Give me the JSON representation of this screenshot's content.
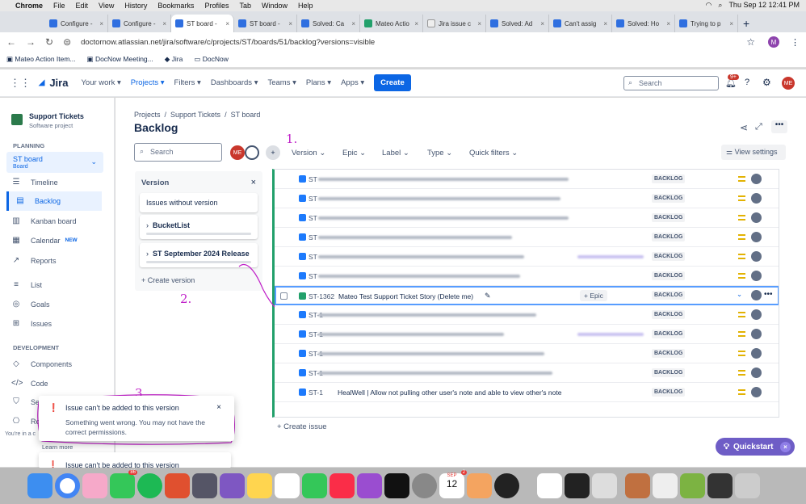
{
  "mac_menu": {
    "apple": "",
    "app": "Chrome",
    "items": [
      "File",
      "Edit",
      "View",
      "History",
      "Bookmarks",
      "Profiles",
      "Tab",
      "Window",
      "Help"
    ],
    "clock": "Thu Sep 12  12:41 PM"
  },
  "tabs": [
    "Configure -",
    "Configure -",
    "ST board -",
    "ST board -",
    "Solved: Ca",
    "Mateo Actio",
    "Jira issue c",
    "Solved: Ad",
    "Can't assig",
    "Solved: Ho",
    "Trying to p"
  ],
  "address": {
    "url": "doctornow.atlassian.net/jira/software/c/projects/ST/boards/51/backlog?versions=visible",
    "profile": "M"
  },
  "bookmarks": [
    "Mateo Action Item...",
    "DocNow Meeting...",
    "Jira",
    "DocNow"
  ],
  "jira_header": {
    "logo": "Jira",
    "nav": [
      "Your work",
      "Projects",
      "Filters",
      "Dashboards",
      "Teams",
      "Plans",
      "Apps"
    ],
    "create": "Create",
    "search": "Search",
    "notif": "9+",
    "avatar": "ME"
  },
  "sidebar": {
    "project": "Support Tickets",
    "project_type": "Software project",
    "planning": "PLANNING",
    "board": "ST board",
    "board_sub": "Board",
    "items": [
      "Timeline",
      "Backlog",
      "Kanban board",
      "Calendar",
      "Reports",
      "List",
      "Goals",
      "Issues"
    ],
    "new_badge": "NEW",
    "development": "DEVELOPMENT",
    "dev_items": [
      "Components",
      "Code",
      "Se",
      "Re"
    ],
    "footer": "You're in a c"
  },
  "main": {
    "breadcrumb": [
      "Projects",
      "Support Tickets",
      "ST board"
    ],
    "title": "Backlog",
    "search": "Search",
    "filters": [
      "Version",
      "Epic",
      "Label",
      "Type",
      "Quick filters"
    ],
    "view_settings": "View settings",
    "avatar": "ME"
  },
  "version_panel": {
    "title": "Version",
    "no_version": "Issues without version",
    "versions": [
      "BucketList",
      "ST September 2024 Release"
    ],
    "create": "+ Create version"
  },
  "issues": [
    {
      "key": "ST",
      "status": "BACKLOG"
    },
    {
      "key": "ST",
      "status": "BACKLOG"
    },
    {
      "key": "ST",
      "status": "BACKLOG"
    },
    {
      "key": "ST",
      "status": "BACKLOG"
    },
    {
      "key": "ST",
      "status": "BACKLOG"
    },
    {
      "key": "ST",
      "status": "BACKLOG"
    },
    {
      "key": "ST-1362",
      "summary": "Mateo Test Support Ticket Story (Delete me)",
      "epic": "+ Epic",
      "status": "BACKLOG"
    },
    {
      "key": "ST-1",
      "status": "BACKLOG"
    },
    {
      "key": "ST-1",
      "status": "BACKLOG"
    },
    {
      "key": "ST-1",
      "status": "BACKLOG"
    },
    {
      "key": "ST-1",
      "status": "BACKLOG"
    },
    {
      "key": "ST-1",
      "summary": "HealWell | Allow not pulling other user's note and able to view other's note",
      "status": "BACKLOG"
    }
  ],
  "create_issue": "+ Create issue",
  "toast": {
    "title": "Issue can't be added to this version",
    "body": "Something went wrong. You may not have the correct permissions.",
    "learn_more": "Learn more"
  },
  "toast2": {
    "title": "Issue can't be added to this version"
  },
  "quickstart": "Quickstart",
  "annotations": [
    "1.",
    "2.",
    "3."
  ],
  "dock": {
    "calendar_month": "SEP",
    "calendar_day": "12",
    "messages_badge": "86",
    "calendar_badge": "2"
  },
  "colors": {
    "accent": "#0c66e4",
    "annotation": "#c020c8",
    "quickstart": "#6e5dc6",
    "error": "#c9372c"
  }
}
